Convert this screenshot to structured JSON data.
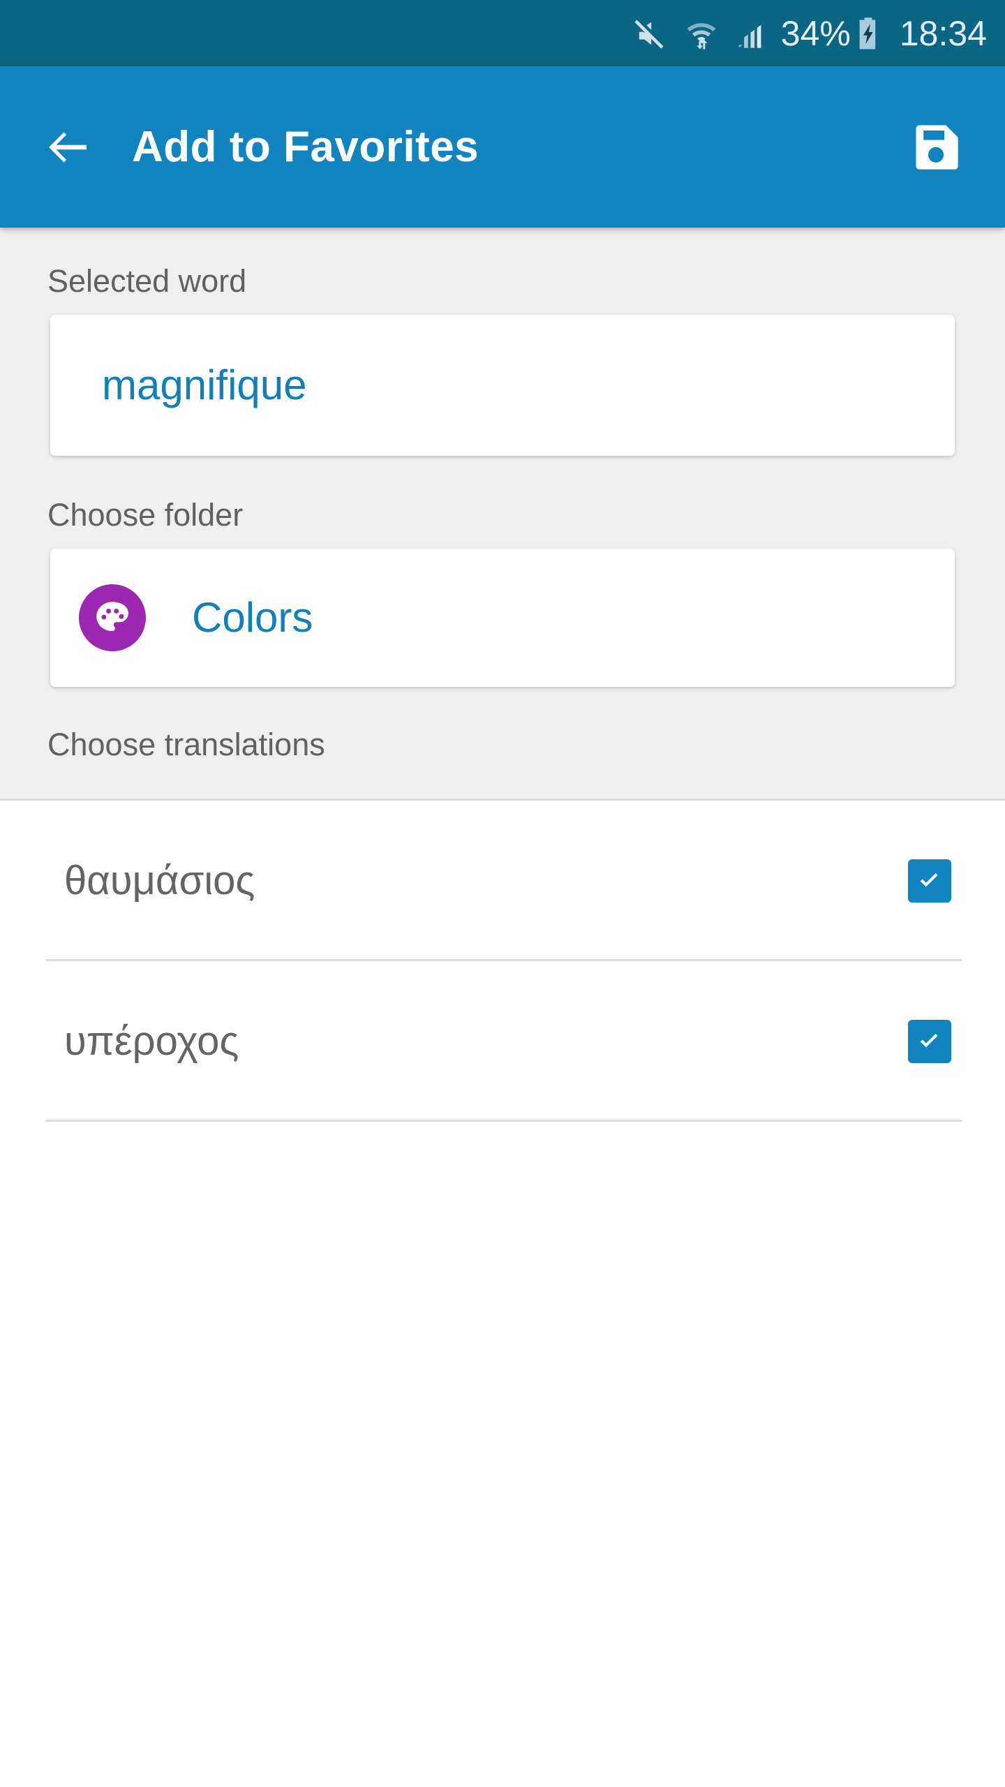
{
  "status_bar": {
    "icons": [
      "mute-icon",
      "wifi-transfer-icon",
      "signal-bars-icon"
    ],
    "battery_percent": "34%",
    "battery_icon": "battery-charging-icon",
    "time": "18:34"
  },
  "app_bar": {
    "back_icon": "back-arrow-icon",
    "title": "Add to Favorites",
    "save_icon": "save-floppy-icon"
  },
  "form": {
    "selected_word_label": "Selected word",
    "selected_word_value": "magnifique",
    "choose_folder_label": "Choose folder",
    "folder_icon": "palette-icon",
    "folder_name": "Colors",
    "choose_translations_label": "Choose translations"
  },
  "translations": [
    {
      "text": "θαυμάσιος",
      "checked": true
    },
    {
      "text": "υπέροχος",
      "checked": true
    }
  ],
  "colors": {
    "status_bar_bg": "#0b6584",
    "app_bar_bg": "#1184c0",
    "page_bg": "#efefef",
    "accent_blue": "#1180b9",
    "folder_purple": "#9c27b0",
    "checkbox_blue": "#1184c0",
    "label_gray": "#616161",
    "row_text_gray": "#646464"
  }
}
